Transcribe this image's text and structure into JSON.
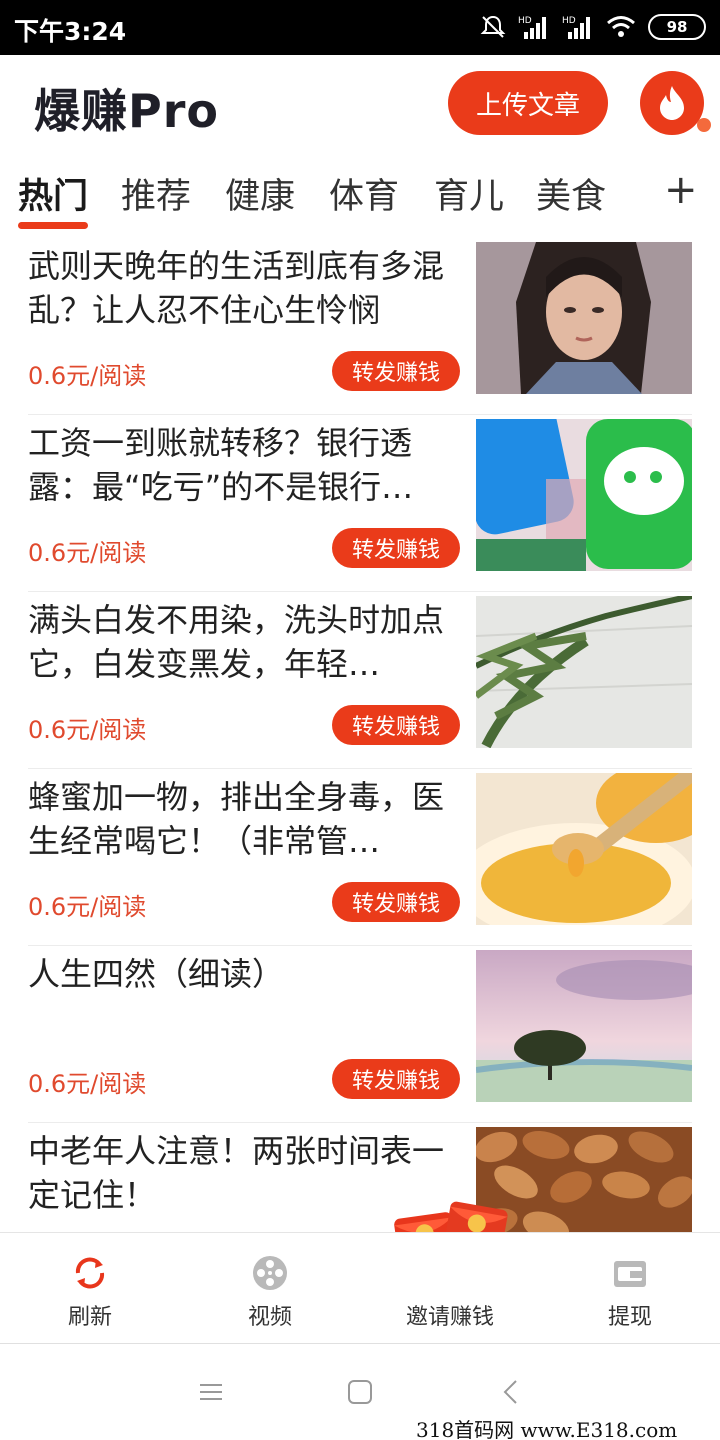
{
  "status_bar": {
    "time": "下午3:24",
    "battery": "98",
    "network_label_1": "HD",
    "network_label_2": "HD"
  },
  "header": {
    "title": "爆赚Pro",
    "upload_label": "上传文章",
    "accent_color": "#ea3b1a"
  },
  "tabs": {
    "items": [
      "热门",
      "推荐",
      "健康",
      "体育",
      "育儿",
      "美食"
    ],
    "active_index": 0,
    "add_label": "+"
  },
  "articles": [
    {
      "title": "武则天晚年的生活到底有多混乱？让人忍不住心生怜悯",
      "reward": "0.6元/阅读",
      "action": "转发赚钱"
    },
    {
      "title": "工资一到账就转移？银行透露：最“吃亏”的不是银行…",
      "reward": "0.6元/阅读",
      "action": "转发赚钱"
    },
    {
      "title": "满头白发不用染，洗头时加点它，白发变黑发，年轻…",
      "reward": "0.6元/阅读",
      "action": "转发赚钱"
    },
    {
      "title": "蜂蜜加一物，排出全身毒，医生经常喝它！（非常管…",
      "reward": "0.6元/阅读",
      "action": "转发赚钱"
    },
    {
      "title": "人生四然（细读）",
      "reward": "0.6元/阅读",
      "action": "转发赚钱"
    },
    {
      "title": "中老年人注意！两张时间表一定记住！",
      "reward": "",
      "action": ""
    }
  ],
  "bottom_nav": {
    "items": [
      {
        "label": "刷新",
        "icon": "refresh-icon"
      },
      {
        "label": "视频",
        "icon": "film-reel-icon"
      },
      {
        "label": "邀请赚钱",
        "icon": "red-envelope-icon"
      },
      {
        "label": "提现",
        "icon": "wallet-icon"
      }
    ]
  },
  "watermark": "318首码网 www.E318.com"
}
